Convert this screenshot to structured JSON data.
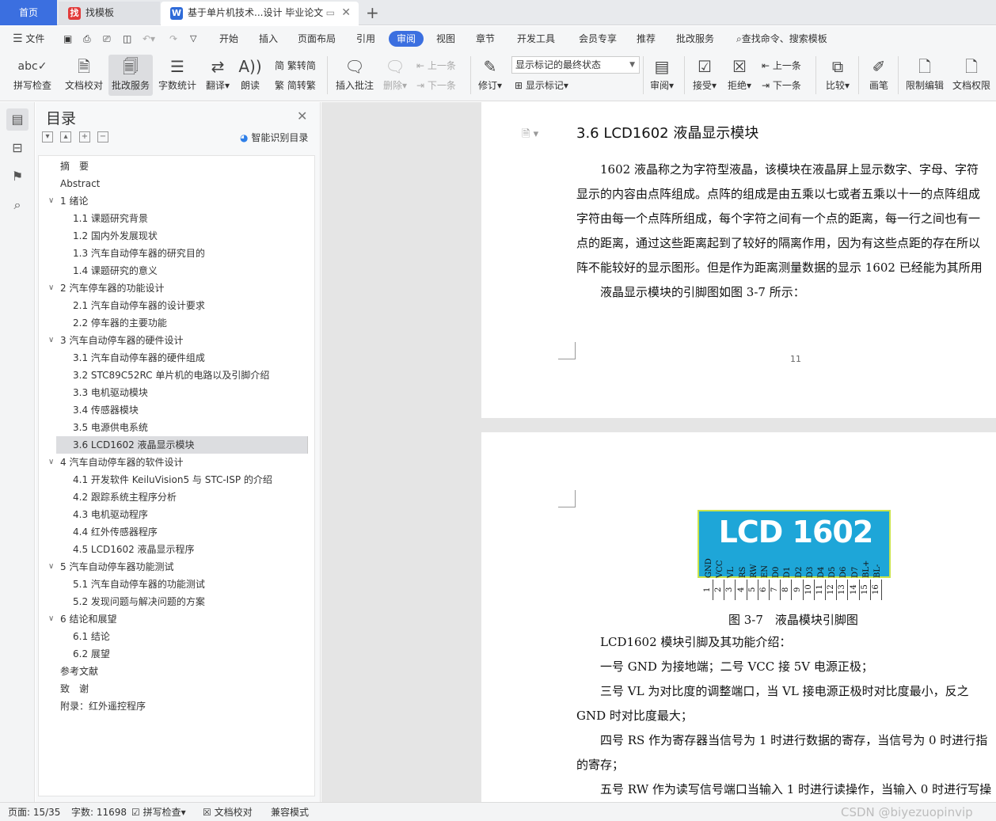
{
  "tabs": {
    "home": "首页",
    "find_template": "找模板",
    "document": "基于单片机技术...设计 毕业论文",
    "add": "+"
  },
  "menu": {
    "file": "文件",
    "items": [
      "开始",
      "插入",
      "页面布局",
      "引用",
      "审阅",
      "视图",
      "章节",
      "开发工具",
      "会员专享",
      "推荐",
      "批改服务"
    ],
    "active": "审阅",
    "search_placeholder": "查找命令、搜索模板"
  },
  "ribbon": {
    "spell_check": "拼写检查",
    "doc_proofread": "文档校对",
    "correction_service": "批改服务",
    "word_count": "字数统计",
    "translate": "翻译",
    "read_aloud": "朗读",
    "trad_to_simp": "繁转简",
    "simp_to_trad": "简转繁",
    "insert_comment": "插入批注",
    "delete": "删除",
    "prev": "上一条",
    "next": "下一条",
    "revise": "修订",
    "markup_state": "显示标记的最终状态",
    "show_markup": "显示标记",
    "review": "审阅",
    "accept": "接受",
    "reject": "拒绝",
    "prev_change": "上一条",
    "next_change": "下一条",
    "compare": "比较",
    "pen": "画笔",
    "restrict_edit": "限制编辑",
    "doc_permission": "文档权限"
  },
  "toc": {
    "title": "目录",
    "smart_toc": "智能识别目录",
    "items": [
      {
        "label": "摘　要",
        "level": 1,
        "arrow": ""
      },
      {
        "label": "Abstract",
        "level": 1,
        "arrow": ""
      },
      {
        "label": "1 绪论",
        "level": 1,
        "arrow": "v"
      },
      {
        "label": "1.1 课题研究背景",
        "level": 2,
        "arrow": ""
      },
      {
        "label": "1.2 国内外发展现状",
        "level": 2,
        "arrow": ""
      },
      {
        "label": "1.3 汽车自动停车器的研究目的",
        "level": 2,
        "arrow": ""
      },
      {
        "label": "1.4 课题研究的意义",
        "level": 2,
        "arrow": ""
      },
      {
        "label": "2 汽车停车器的功能设计",
        "level": 1,
        "arrow": "v"
      },
      {
        "label": "2.1 汽车自动停车器的设计要求",
        "level": 2,
        "arrow": ""
      },
      {
        "label": "2.2 停车器的主要功能",
        "level": 2,
        "arrow": ""
      },
      {
        "label": "3 汽车自动停车器的硬件设计",
        "level": 1,
        "arrow": "v"
      },
      {
        "label": "3.1 汽车自动停车器的硬件组成",
        "level": 2,
        "arrow": ""
      },
      {
        "label": "3.2 STC89C52RC 单片机的电路以及引脚介绍",
        "level": 2,
        "arrow": ""
      },
      {
        "label": "3.3 电机驱动模块",
        "level": 2,
        "arrow": ""
      },
      {
        "label": "3.4 传感器模块",
        "level": 2,
        "arrow": ""
      },
      {
        "label": "3.5  电源供电系统",
        "level": 2,
        "arrow": ""
      },
      {
        "label": "3.6 LCD1602 液晶显示模块",
        "level": 2,
        "arrow": "",
        "selected": true
      },
      {
        "label": "4 汽车自动停车器的软件设计",
        "level": 1,
        "arrow": "v"
      },
      {
        "label": "4.1 开发软件 KeiluVision5 与 STC-ISP 的介绍",
        "level": 2,
        "arrow": ""
      },
      {
        "label": "4.2 跟踪系统主程序分析",
        "level": 2,
        "arrow": ""
      },
      {
        "label": "4.3 电机驱动程序",
        "level": 2,
        "arrow": ""
      },
      {
        "label": "4.4 红外传感器程序",
        "level": 2,
        "arrow": ""
      },
      {
        "label": "4.5 LCD1602 液晶显示程序",
        "level": 2,
        "arrow": ""
      },
      {
        "label": "5 汽车自动停车器功能测试",
        "level": 1,
        "arrow": "v"
      },
      {
        "label": "5.1 汽车自动停车器的功能测试",
        "level": 2,
        "arrow": ""
      },
      {
        "label": "5.2 发现问题与解决问题的方案",
        "level": 2,
        "arrow": ""
      },
      {
        "label": "6 结论和展望",
        "level": 1,
        "arrow": "v"
      },
      {
        "label": "6.1 结论",
        "level": 2,
        "arrow": ""
      },
      {
        "label": "6.2 展望",
        "level": 2,
        "arrow": ""
      },
      {
        "label": "参考文献",
        "level": 1,
        "arrow": ""
      },
      {
        "label": "致　谢",
        "level": 1,
        "arrow": ""
      },
      {
        "label": "附录：红外遥控程序",
        "level": 1,
        "arrow": ""
      }
    ]
  },
  "document": {
    "heading": "3.6 LCD1602 液晶显示模块",
    "page1_lines": [
      "　　1602 液晶称之为字符型液晶，该模块在液晶屏上显示数字、字母、字符",
      "显示的内容由点阵组成。点阵的组成是由五乘以七或者五乘以十一的点阵组成",
      "字符由每一个点阵所组成，每个字符之间有一个点的距离，每一行之间也有一",
      "点的距离，通过这些距离起到了较好的隔离作用，因为有这些点距的存在所以",
      "阵不能较好的显示图形。但是作为距离测量数据的显示 1602 已经能为其所用",
      "　　液晶显示模块的引脚图如图 3-7 所示："
    ],
    "page_number": "11",
    "lcd_title": "LCD 1602",
    "lcd_pin_labels": [
      "GND",
      "VCC",
      "VL",
      "RS",
      "RW",
      "EN",
      "D0",
      "D1",
      "D2",
      "D3",
      "D4",
      "D5",
      "D6",
      "D7",
      "BL+",
      "BL-"
    ],
    "lcd_pin_numbers": [
      "1",
      "2",
      "3",
      "4",
      "5",
      "6",
      "7",
      "8",
      "9",
      "10",
      "11",
      "12",
      "13",
      "14",
      "15",
      "16"
    ],
    "figure_caption": "图 3-7　液晶模块引脚图",
    "page2_lines": [
      "　　LCD1602 模块引脚及其功能介绍：",
      "　　一号 GND 为接地端；二号 VCC 接 5V 电源正极；",
      "　　三号 VL 为对比度的调整端口，当 VL 接电源正极时对比度最小，反之",
      "GND 时对比度最大；",
      "　　四号 RS 作为寄存器当信号为 1 时进行数据的寄存，当信号为 0 时进行指",
      "的寄存；",
      "　　五号 RW 作为读写信号端口当输入 1 时进行读操作，当输入 0 时进行写操"
    ]
  },
  "status": {
    "page": "页面: 15/35",
    "words": "字数: 11698",
    "spell_check": "拼写检查",
    "doc_proofread": "文档校对",
    "compat_mode": "兼容模式"
  },
  "watermark": "CSDN @biyezuopinvip"
}
